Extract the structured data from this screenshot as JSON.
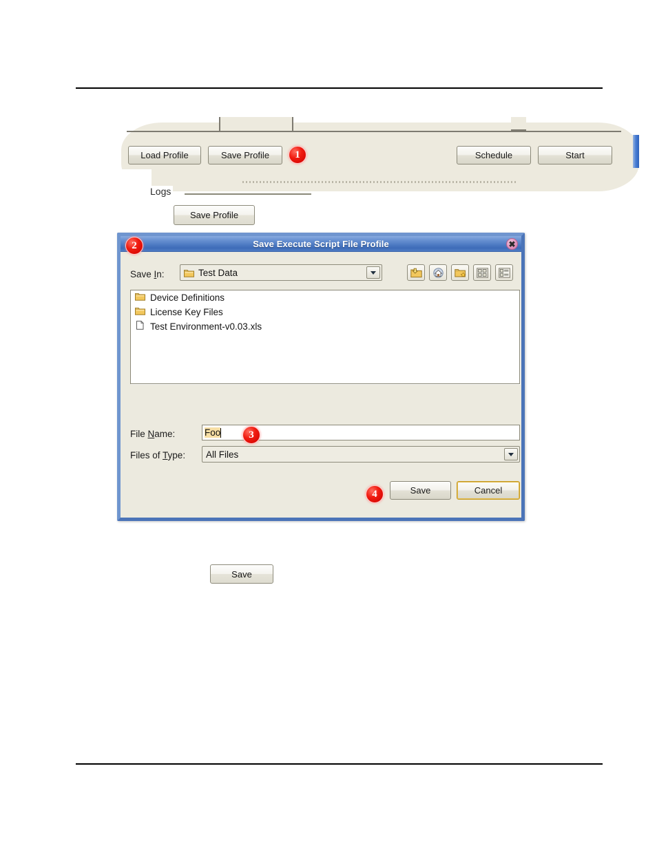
{
  "app_panel": {
    "buttons": [
      {
        "label": "Load Profile"
      },
      {
        "label": "Save Profile"
      },
      {
        "label": "Schedule"
      },
      {
        "label": "Start"
      }
    ],
    "group_label": "Logs"
  },
  "callouts": {
    "one": "1",
    "two": "2",
    "three": "3",
    "four": "4"
  },
  "standalone": {
    "save_profile_label": "Save Profile",
    "save_label": "Save"
  },
  "dialog": {
    "title": "Save Execute Script File Profile",
    "close_icon": "close-icon",
    "save_in": {
      "label": "Save In:",
      "label_pre": "Save ",
      "label_key": "I",
      "label_post": "n:",
      "value": "Test Data",
      "icon": "folder-icon"
    },
    "toolbar_icons": [
      {
        "name": "up-one-level-icon"
      },
      {
        "name": "home-icon"
      },
      {
        "name": "create-new-folder-icon"
      },
      {
        "name": "list-view-icon"
      },
      {
        "name": "details-view-icon"
      }
    ],
    "file_list": [
      {
        "name": "Device Definitions",
        "type": "folder"
      },
      {
        "name": "License Key Files",
        "type": "folder"
      },
      {
        "name": "Test Environment-v0.03.xls",
        "type": "file"
      }
    ],
    "file_name": {
      "label_pre": "File ",
      "label_key": "N",
      "label_post": "ame:",
      "value": "Foo"
    },
    "files_of_type": {
      "label_pre": "Files of ",
      "label_key": "T",
      "label_post": "ype:",
      "value": "All Files"
    },
    "buttons": {
      "save_label": "Save",
      "cancel_label": "Cancel"
    }
  },
  "colors": {
    "titlebar_blue": "#4f7cc4",
    "dialog_bg": "#eceadf",
    "badge_red": "#e00000",
    "focus_gold": "#c59a22",
    "selection_amber": "#f7dfa5"
  }
}
